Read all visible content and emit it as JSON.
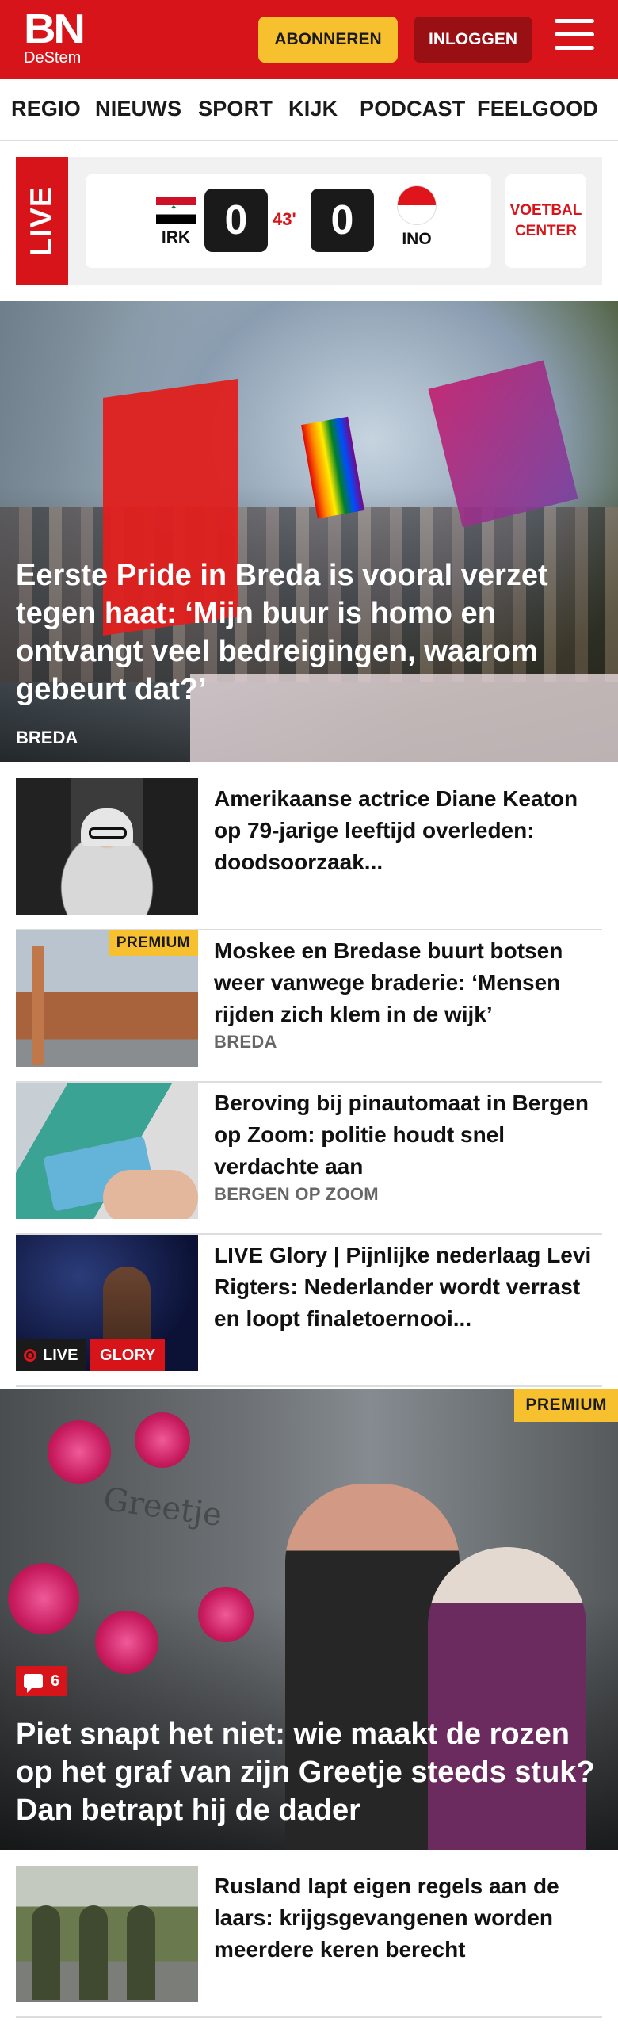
{
  "header": {
    "logo_main": "BN",
    "logo_sub": "DeStem",
    "subscribe_label": "ABONNEREN",
    "login_label": "INLOGGEN",
    "brand_color": "#d8141b"
  },
  "nav": {
    "items": [
      "REGIO",
      "NIEUWS",
      "SPORT",
      "KIJK",
      "PODCAST",
      "FEELGOOD"
    ]
  },
  "live_score": {
    "live_label": "LIVE",
    "home": {
      "code": "IRK",
      "score": "0"
    },
    "away": {
      "code": "INO",
      "score": "0"
    },
    "minute": "43'",
    "voetbal_center_label": "VOETBAL CENTER"
  },
  "hero": {
    "title": "Eerste Pride in Breda is vooral verzet tegen haat: ‘Mijn buur is homo en ontvangt veel bedreigingen, waarom gebeurt dat?’",
    "tag": "BREDA"
  },
  "articles": [
    {
      "title": "Amerikaanse actrice Diane Keaton op 79-jarige leeftijd overleden: doodsoorzaak...",
      "tag": "",
      "premium": false
    },
    {
      "title": "Moskee en Bredase buurt botsen weer vanwege braderie: ‘Mensen rijden zich klem in de wijk’",
      "tag": "BREDA",
      "premium": true,
      "premium_label": "PREMIUM"
    },
    {
      "title": "Beroving bij pinautomaat in Bergen op Zoom: politie houdt snel verdachte aan",
      "tag": "BERGEN OP ZOOM",
      "premium": false
    },
    {
      "title": "LIVE Glory | Pijnlijke nederlaag Levi Rigters: Nederlander wordt verrast en loopt finaletoernooi...",
      "tag": "",
      "live_label": "LIVE",
      "category_label": "GLORY"
    }
  ],
  "feature": {
    "premium_label": "PREMIUM",
    "comment_count": "6",
    "title": "Piet snapt het niet: wie maakt de rozen op het graf van zijn Greetje steeds stuk? Dan betrapt hij de dader",
    "stone_text": "Greetje"
  },
  "article_after": {
    "title": "Rusland lapt eigen regels aan de laars: krijgsgevangenen worden meerdere keren berecht"
  }
}
